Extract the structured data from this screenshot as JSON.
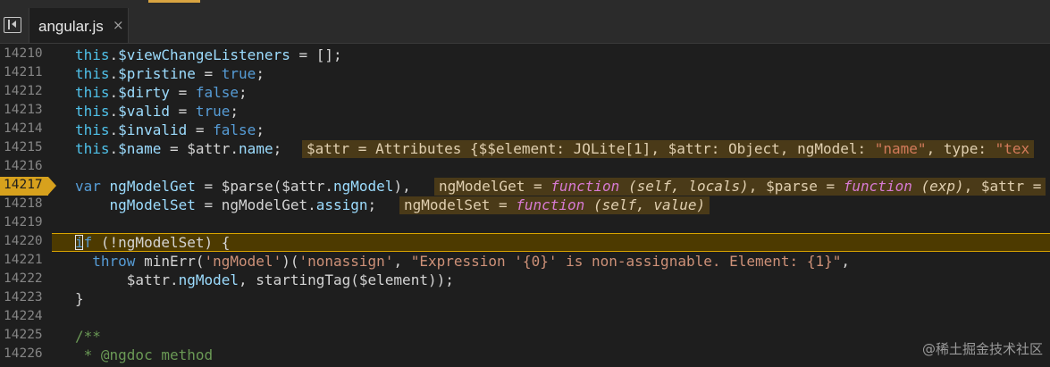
{
  "tab": {
    "label": "angular.js",
    "close_symbol": "×"
  },
  "icons": {
    "panel_toggle": "panel-toggle-icon",
    "close": "close-icon"
  },
  "colors": {
    "accent": "#d9a441",
    "breakpoint": "#d7a11d",
    "current_line": "#4d3a00"
  },
  "lines": [
    {
      "number": "14210",
      "text": "this.$viewChangeListeners = [];"
    },
    {
      "number": "14211",
      "text": "this.$pristine = true;"
    },
    {
      "number": "14212",
      "text": "this.$dirty = false;"
    },
    {
      "number": "14213",
      "text": "this.$valid = true;"
    },
    {
      "number": "14214",
      "text": "this.$invalid = false;"
    },
    {
      "number": "14215",
      "text": "this.$name = $attr.name;",
      "inline_value": "$attr = Attributes {$$element: JQLite[1], $attr: Object, ngModel: \"name\", type: \"tex"
    },
    {
      "number": "14216",
      "text": ""
    },
    {
      "number": "14217",
      "text": "var ngModelGet = $parse($attr.ngModel),",
      "inline_value": "ngModelGet = function (self, locals), $parse = function (exp), $attr =",
      "breakpoint": true
    },
    {
      "number": "14218",
      "text": "    ngModelSet = ngModelGet.assign;",
      "inline_value": "ngModelSet = function (self, value)"
    },
    {
      "number": "14219",
      "text": ""
    },
    {
      "number": "14220",
      "text": "if (!ngModelSet) {",
      "current": true
    },
    {
      "number": "14221",
      "text": "  throw minErr('ngModel')('nonassign', \"Expression '{0}' is non-assignable. Element: {1}\","
    },
    {
      "number": "14222",
      "text": "      $attr.ngModel, startingTag($element));"
    },
    {
      "number": "14223",
      "text": "}"
    },
    {
      "number": "14224",
      "text": ""
    },
    {
      "number": "14225",
      "text": "/**"
    },
    {
      "number": "14226",
      "text": " * @ngdoc method"
    }
  ],
  "watermark": "@稀土掘金技术社区"
}
